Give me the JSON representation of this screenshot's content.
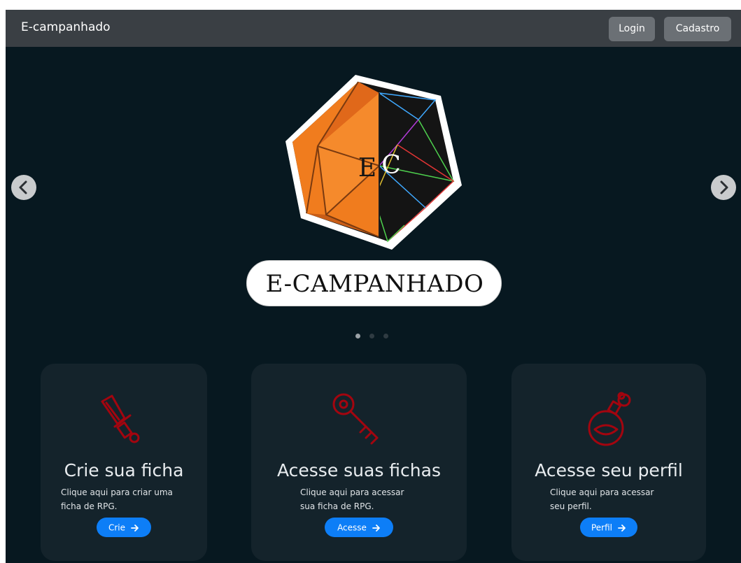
{
  "navbar": {
    "brand": "E-campanhado",
    "login_label": "Login",
    "register_label": "Cadastro"
  },
  "carousel": {
    "logo_initials": "EC",
    "logo_text": "E-CAMPANHADO",
    "active_slide": 1,
    "slide_count": 3,
    "prev_icon": "chevron-left-icon",
    "next_icon": "chevron-right-icon"
  },
  "cards": [
    {
      "icon": "sword-icon",
      "title": "Crie sua ficha",
      "description_line1": "Clique aqui para criar uma",
      "description_line2": "ficha de RPG.",
      "button_label": "Crie"
    },
    {
      "icon": "key-icon",
      "title": "Acesse suas fichas",
      "description_line1": "Clique aqui para acessar",
      "description_line2": "sua ficha de RPG.",
      "button_label": "Acesse"
    },
    {
      "icon": "potion-icon",
      "title": "Acesse seu perfil",
      "description_line1": "Clique aqui para acessar",
      "description_line2": "seu perfil.",
      "button_label": "Perfil"
    }
  ],
  "colors": {
    "background": "#071820",
    "navbar": "#3a3f44",
    "card": "#14232b",
    "primary_button": "#0d7ef7",
    "icon_red": "#a3050f",
    "logo_orange": "#f07c1e"
  }
}
